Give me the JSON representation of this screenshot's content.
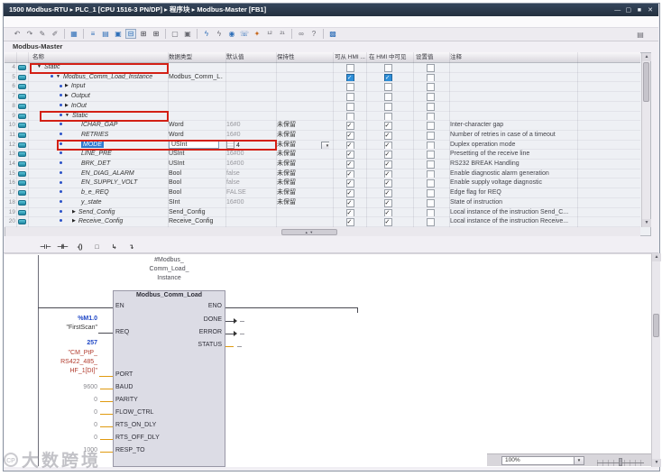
{
  "title_bar": {
    "breadcrumb": "1500 Modbus-RTU  ▸  PLC_1 [CPU 1516-3 PN/DP]  ▸  程序块  ▸  Modbus-Master [FB1]",
    "controls": [
      "—",
      "▢",
      "■",
      "✕"
    ]
  },
  "toolbar": {
    "icons": [
      {
        "name": "undo-icon",
        "glyph": "↶",
        "c": "g"
      },
      {
        "name": "redo-icon",
        "glyph": "↷",
        "c": "g"
      },
      {
        "name": "edit-start-values-icon",
        "glyph": "✎",
        "c": "g"
      },
      {
        "name": "edit-snapshot-icon",
        "glyph": "✐",
        "c": "g"
      },
      {
        "sep": true
      },
      {
        "name": "block-interface-icon",
        "glyph": "▦",
        "c": "b"
      },
      {
        "sep": true
      },
      {
        "name": "expand-all-icon",
        "glyph": "≡",
        "c": "b"
      },
      {
        "name": "collapse-all-icon",
        "glyph": "▤",
        "c": "b"
      },
      {
        "name": "keep-actual-values-icon",
        "glyph": "▣",
        "c": "b"
      },
      {
        "name": "monitor-toggle-icon",
        "glyph": "⊟",
        "c": "b",
        "pressed": true
      },
      {
        "name": "insert-row-icon",
        "glyph": "⊞",
        "c": "d"
      },
      {
        "name": "add-row-icon",
        "glyph": "⊞",
        "c": "d"
      },
      {
        "sep": true
      },
      {
        "name": "window-split-icon",
        "glyph": "▢",
        "c": "g"
      },
      {
        "name": "window-float-icon",
        "glyph": "▣",
        "c": "g"
      },
      {
        "sep": true
      },
      {
        "name": "monitor-all-icon",
        "glyph": "ϟ",
        "c": "b"
      },
      {
        "name": "modify-values-icon",
        "glyph": "ϟ",
        "c": "g"
      },
      {
        "name": "snapshot-icon",
        "glyph": "◉",
        "c": "b"
      },
      {
        "name": "load-snapshot-icon",
        "glyph": "☏",
        "c": "b"
      },
      {
        "name": "setpoint-init-icon",
        "glyph": "✦",
        "c": "o"
      },
      {
        "name": "copy-snapshot-to-start-icon",
        "glyph": "¹²",
        "c": "g"
      },
      {
        "name": "copy-start-to-snapshot-icon",
        "glyph": "²¹",
        "c": "g"
      },
      {
        "sep": true
      },
      {
        "name": "cross-reference-icon",
        "glyph": "∞",
        "c": "g"
      },
      {
        "name": "syntax-check-icon",
        "glyph": "?",
        "c": "g"
      },
      {
        "sep": true
      },
      {
        "name": "grid-view-icon",
        "glyph": "▩",
        "c": "b"
      }
    ],
    "right_icon": {
      "name": "maximize-editor-icon",
      "glyph": "▤"
    }
  },
  "tab_label": "Modbus-Master",
  "table": {
    "columns": [
      "名称",
      "数据类型",
      "默认值",
      "保持性",
      "可从 HMI ...",
      "在 HMI 中可见",
      "设置值",
      "注释"
    ],
    "rows": [
      {
        "num": "4",
        "icon": true,
        "level": 0,
        "expander": "open",
        "name": "Static",
        "cb": [
          "empty",
          "empty",
          "empty"
        ],
        "red": "a"
      },
      {
        "num": "5",
        "icon": true,
        "level": 1,
        "bullet": true,
        "expander": "open",
        "name": "Modbus_Comm_Load_Instance",
        "type": "Modbus_Comm_L...",
        "cb": [
          "blue",
          "blue",
          "empty"
        ]
      },
      {
        "num": "6",
        "icon": true,
        "level": 2,
        "bullet": true,
        "expander": "closed",
        "name": "Input",
        "cb": [
          "empty",
          "empty",
          "empty"
        ]
      },
      {
        "num": "7",
        "icon": true,
        "level": 2,
        "bullet": true,
        "expander": "closed",
        "name": "Output",
        "cb": [
          "empty",
          "empty",
          "empty"
        ]
      },
      {
        "num": "8",
        "icon": true,
        "level": 2,
        "bullet": true,
        "expander": "closed",
        "name": "InOut",
        "cb": [
          "empty",
          "empty",
          "empty"
        ]
      },
      {
        "num": "9",
        "icon": true,
        "level": 2,
        "bullet": true,
        "expander": "open",
        "name": "Static",
        "cb": [
          "empty",
          "empty",
          "empty"
        ],
        "red": "b"
      },
      {
        "num": "10",
        "icon": true,
        "level": 3,
        "bullet": true,
        "name": "ICHAR_GAP",
        "type": "Word",
        "default": "16#0",
        "retain": "未保留",
        "cb": [
          "check",
          "check",
          "empty"
        ],
        "comment": "Inter-character gap"
      },
      {
        "num": "11",
        "icon": true,
        "level": 3,
        "bullet": true,
        "name": "RETRIES",
        "type": "Word",
        "default": "16#0",
        "retain": "未保留",
        "cb": [
          "check",
          "check",
          "empty"
        ],
        "comment": "Number of retries in case of a timeout"
      },
      {
        "num": "12",
        "icon": true,
        "level": 3,
        "bullet": true,
        "name": "MODE",
        "selected": true,
        "type": "USInt",
        "type_boxed": true,
        "default": "4",
        "default_icon": true,
        "retain": "未保留",
        "retain_combo": true,
        "cb": [
          "check",
          "check",
          "empty"
        ],
        "comment": "Duplex operation mode",
        "red": "c"
      },
      {
        "num": "13",
        "icon": true,
        "level": 3,
        "bullet": true,
        "name": "LINE_PRE",
        "type": "USInt",
        "default": "16#00",
        "retain": "未保留",
        "cb": [
          "check",
          "check",
          "empty"
        ],
        "comment": "Presetting of the receive line"
      },
      {
        "num": "14",
        "icon": true,
        "level": 3,
        "bullet": true,
        "name": "BRK_DET",
        "type": "USInt",
        "default": "16#00",
        "retain": "未保留",
        "cb": [
          "check",
          "check",
          "empty"
        ],
        "comment": "RS232 BREAK Handling"
      },
      {
        "num": "15",
        "icon": true,
        "level": 3,
        "bullet": true,
        "name": "EN_DIAG_ALARM",
        "type": "Bool",
        "default": "false",
        "retain": "未保留",
        "cb": [
          "check",
          "check",
          "empty"
        ],
        "comment": "Enable diagnostic alarm generation"
      },
      {
        "num": "16",
        "icon": true,
        "level": 3,
        "bullet": true,
        "name": "EN_SUPPLY_VOLT",
        "type": "Bool",
        "default": "false",
        "retain": "未保留",
        "cb": [
          "check",
          "check",
          "empty"
        ],
        "comment": "Enable supply voltage diagnostic"
      },
      {
        "num": "17",
        "icon": true,
        "level": 3,
        "bullet": true,
        "name": "b_e_REQ",
        "type": "Bool",
        "default": "FALSE",
        "retain": "未保留",
        "cb": [
          "check",
          "check",
          "empty"
        ],
        "comment": "Edge flag for REQ"
      },
      {
        "num": "18",
        "icon": true,
        "level": 3,
        "bullet": true,
        "name": "y_state",
        "type": "SInt",
        "default": "16#00",
        "retain": "未保留",
        "cb": [
          "check",
          "check",
          "empty"
        ],
        "comment": "State of instruction"
      },
      {
        "num": "19",
        "icon": true,
        "level": 4,
        "bullet": true,
        "expander": "closed",
        "name": "Send_Config",
        "type": "Send_Config",
        "cb": [
          "check",
          "check",
          "empty"
        ],
        "comment": "Local instance of the instruction Send_C..."
      },
      {
        "num": "20",
        "icon": true,
        "level": 4,
        "bullet": true,
        "expander": "closed",
        "name": "Receive_Config",
        "type": "Receive_Config",
        "cb": [
          "check",
          "check",
          "empty"
        ],
        "comment": "Local instance of the instruction Receive..."
      }
    ]
  },
  "lad_toolbar": {
    "icons": [
      {
        "name": "open-contact-icon",
        "glyph": "⊣ ⊢"
      },
      {
        "name": "closed-contact-icon",
        "glyph": "⊣/⊢"
      },
      {
        "name": "coil-icon",
        "glyph": "-( )"
      },
      {
        "name": "empty-box-icon",
        "glyph": "□"
      },
      {
        "name": "open-branch-icon",
        "glyph": "↳"
      },
      {
        "name": "close-branch-icon",
        "glyph": "↴"
      }
    ]
  },
  "lad": {
    "instance_label_lines": [
      "#Modbus_",
      "Comm_Load_",
      "Instance"
    ],
    "block_title": "Modbus_Comm_Load",
    "en_pin": "EN",
    "req": {
      "pin": "REQ",
      "addr": "%M1.0",
      "name": "\"FirstScan\""
    },
    "port": {
      "pin": "PORT",
      "addr": "257",
      "name_lines": [
        "\"CM_PtP_",
        "RS422_485_",
        "HF_1[DI]\""
      ]
    },
    "value_pins": [
      {
        "pin": "BAUD",
        "value": "9600"
      },
      {
        "pin": "PARITY",
        "value": "0"
      },
      {
        "pin": "FLOW_CTRL",
        "value": "0"
      },
      {
        "pin": "RTS_ON_DLY",
        "value": "0"
      },
      {
        "pin": "RTS_OFF_DLY",
        "value": "0"
      },
      {
        "pin": "RESP_TO",
        "value": "1000"
      }
    ],
    "out_pins": [
      "ENO",
      "DONE",
      "ERROR",
      "STATUS"
    ]
  },
  "status": {
    "zoom_value": "100%"
  },
  "watermark": {
    "logo_text": "CP",
    "text": "大数跨境"
  }
}
